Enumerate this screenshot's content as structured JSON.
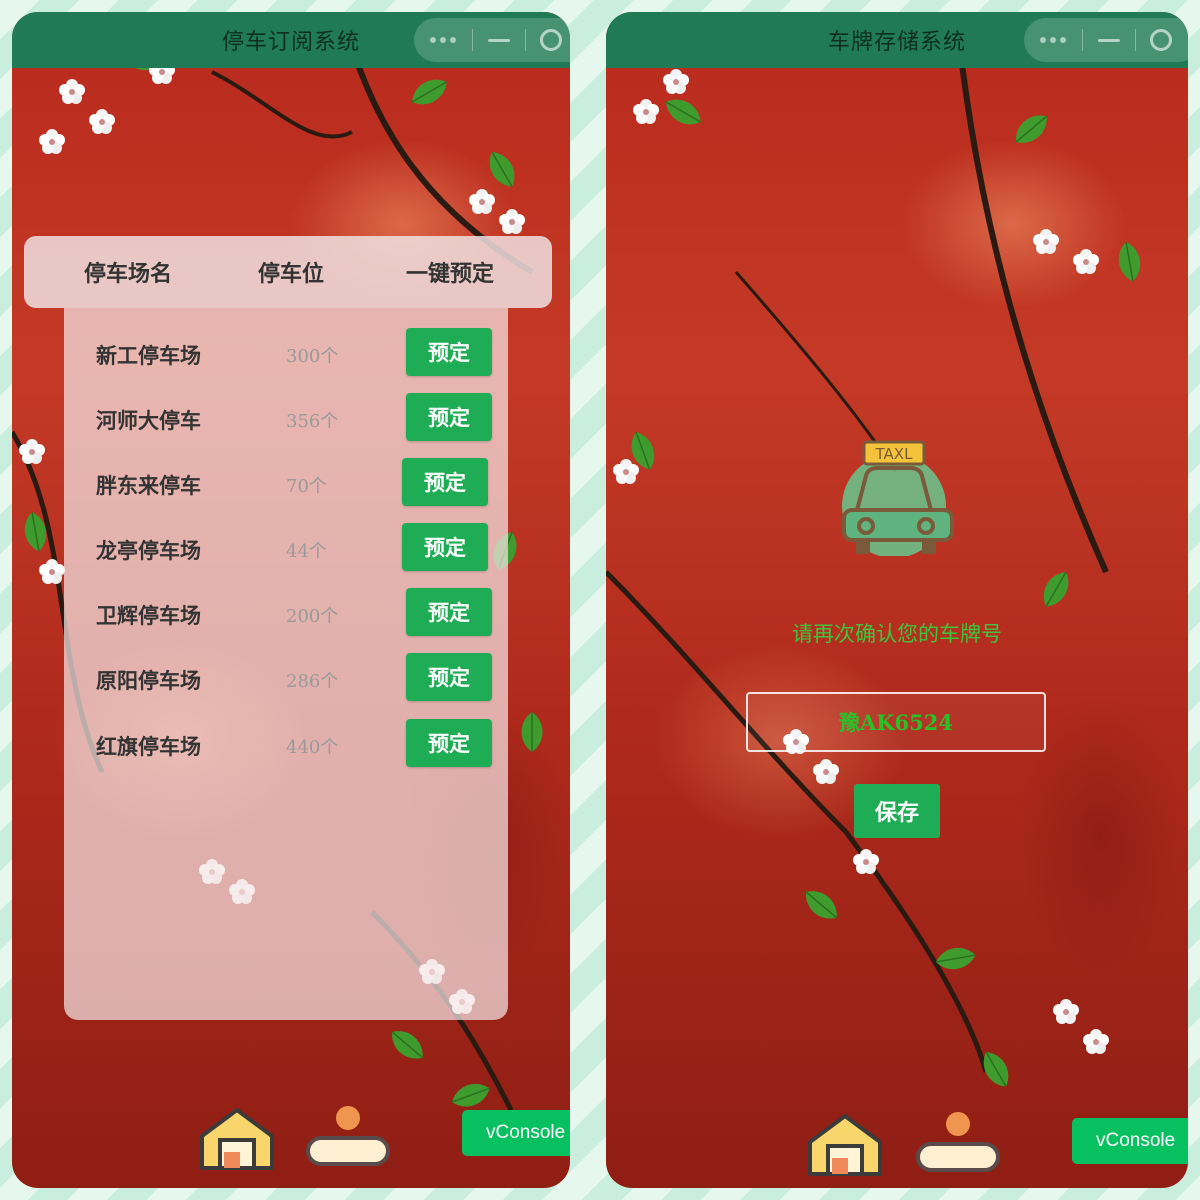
{
  "left_screen": {
    "title": "停车订阅系统",
    "table": {
      "headers": [
        "停车场名",
        "停车位",
        "一键预定"
      ],
      "rows": [
        {
          "name": "新工停车场",
          "spots": "300个",
          "action": "预定"
        },
        {
          "name": "河师大停车",
          "spots": "356个",
          "action": "预定"
        },
        {
          "name": "胖东来停车",
          "spots": "70个",
          "action": "预定"
        },
        {
          "name": "龙亭停车场",
          "spots": "44个",
          "action": "预定"
        },
        {
          "name": "卫辉停车场",
          "spots": "200个",
          "action": "预定"
        },
        {
          "name": "原阳停车场",
          "spots": "286个",
          "action": "预定"
        },
        {
          "name": "红旗停车场",
          "spots": "440个",
          "action": "预定"
        }
      ]
    },
    "vconsole_label": "vConsole"
  },
  "right_screen": {
    "title": "车牌存储系统",
    "taxi_sign": "TAXL",
    "confirm_text": "请再次确认您的车牌号",
    "plate_value": "豫AK6524",
    "save_label": "保存",
    "vconsole_label": "vConsole"
  },
  "tabbar": {
    "items": [
      {
        "icon": "house-icon"
      },
      {
        "icon": "person-icon"
      }
    ]
  },
  "colors": {
    "titlebar": "#1f7a55",
    "button": "#1ead55",
    "vconsole": "#07c160",
    "confirm_text": "#3ec43e"
  }
}
